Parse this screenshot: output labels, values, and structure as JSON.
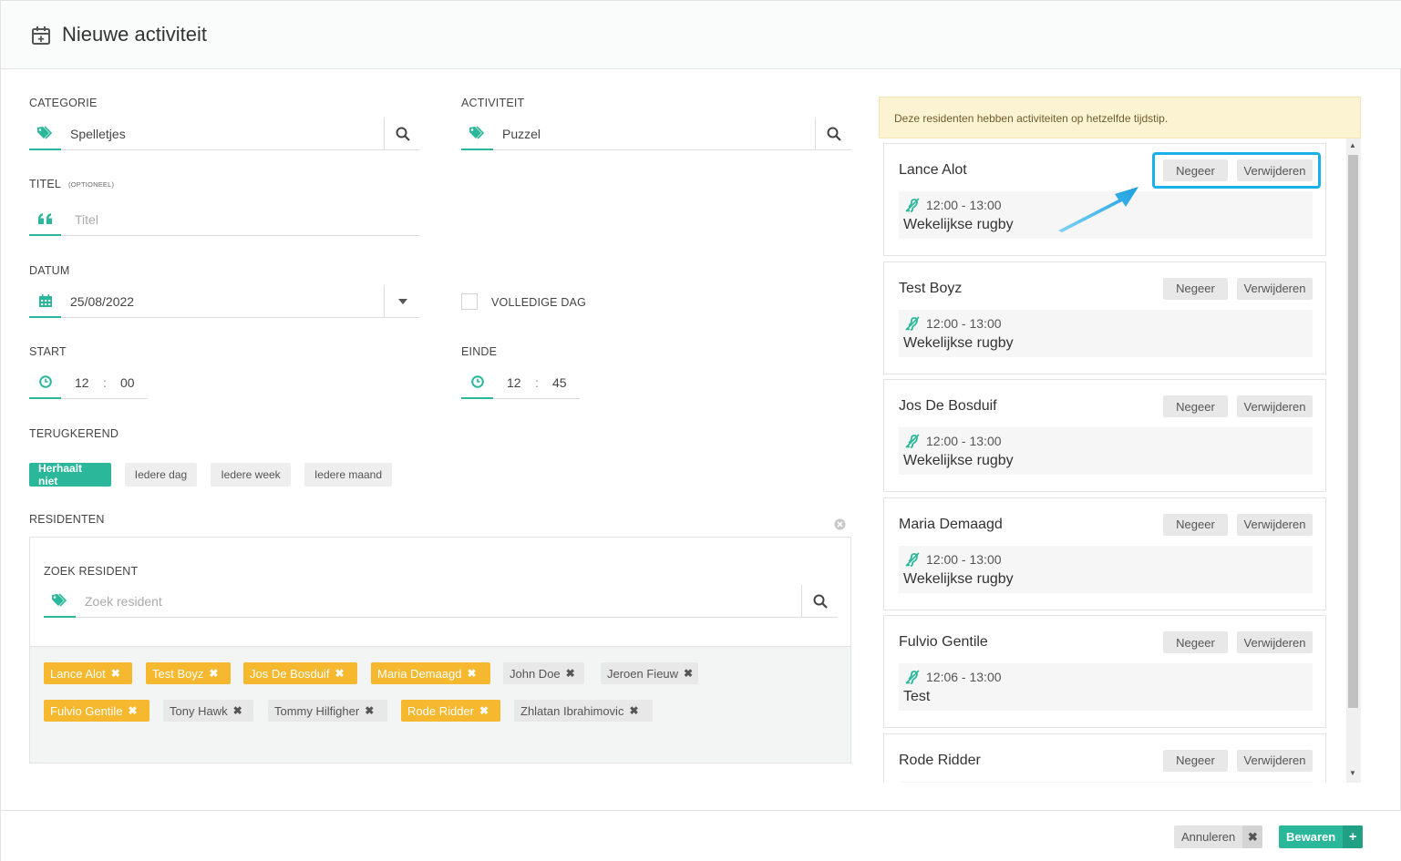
{
  "header": {
    "title": "Nieuwe activiteit",
    "icon": "calendar-plus-icon"
  },
  "form": {
    "category": {
      "label": "CATEGORIE",
      "value": "Spelletjes"
    },
    "activity": {
      "label": "ACTIVITEIT",
      "value": "Puzzel"
    },
    "title": {
      "label": "TITEL",
      "optional": "(OPTIONEEL)",
      "placeholder": "Titel"
    },
    "date": {
      "label": "DATUM",
      "value": "25/08/2022"
    },
    "fullday": {
      "label": "VOLLEDIGE DAG"
    },
    "start": {
      "label": "START",
      "hour": "12",
      "minute": "00",
      "sep": ":"
    },
    "end": {
      "label": "EINDE",
      "hour": "12",
      "minute": "45",
      "sep": ":"
    },
    "recurring": {
      "label": "TERUGKEREND",
      "options": [
        "Herhaalt niet",
        "Iedere dag",
        "Iedere week",
        "Iedere maand"
      ],
      "selected": "Herhaalt niet"
    },
    "residents": {
      "label": "RESIDENTEN",
      "search_label": "ZOEK RESIDENT",
      "search_placeholder": "Zoek resident",
      "tags": [
        {
          "name": "Lance Alot",
          "selected": true
        },
        {
          "name": "Test Boyz",
          "selected": true
        },
        {
          "name": "Jos De Bosduif",
          "selected": true
        },
        {
          "name": "Maria Demaagd",
          "selected": true
        },
        {
          "name": "John Doe",
          "selected": false
        },
        {
          "name": "Jeroen Fieuw",
          "selected": false
        },
        {
          "name": "Fulvio Gentile",
          "selected": true
        },
        {
          "name": "Tony Hawk",
          "selected": false
        },
        {
          "name": "Tommy Hilfigher",
          "selected": false
        },
        {
          "name": "Rode Ridder",
          "selected": true
        },
        {
          "name": "Zhlatan Ibrahimovic",
          "selected": false
        }
      ],
      "remove_glyph": "✖"
    }
  },
  "conflicts": {
    "warning": "Deze residenten hebben activiteiten op hetzelfde tijdstip.",
    "ignore_label": "Negeer",
    "delete_label": "Verwijderen",
    "items": [
      {
        "name": "Lance Alot",
        "time": "12:00 - 13:00",
        "activity": "Wekelijkse rugby"
      },
      {
        "name": "Test Boyz",
        "time": "12:00 - 13:00",
        "activity": "Wekelijkse rugby"
      },
      {
        "name": "Jos De Bosduif",
        "time": "12:00 - 13:00",
        "activity": "Wekelijkse rugby"
      },
      {
        "name": "Maria Demaagd",
        "time": "12:00 - 13:00",
        "activity": "Wekelijkse rugby"
      },
      {
        "name": "Fulvio Gentile",
        "time": "12:06 - 13:00",
        "activity": "Test"
      },
      {
        "name": "Rode Ridder",
        "time": "",
        "activity": ""
      }
    ]
  },
  "footer": {
    "cancel_label": "Annuleren",
    "save_label": "Bewaren"
  },
  "colors": {
    "accent": "#2bb89a",
    "tag_selected": "#f5b82e",
    "highlight": "#1ab0ea"
  }
}
